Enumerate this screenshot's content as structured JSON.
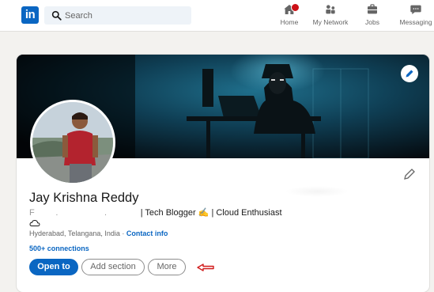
{
  "nav": {
    "logo_text": "in",
    "search_placeholder": "Search",
    "items": [
      {
        "label": "Home",
        "icon": "home-icon"
      },
      {
        "label": "My Network",
        "icon": "network-icon"
      },
      {
        "label": "Jobs",
        "icon": "jobs-icon"
      },
      {
        "label": "Messaging",
        "icon": "messaging-icon"
      }
    ]
  },
  "profile": {
    "name": "Jay Krishna Reddy",
    "headline_blurred": "F        .                  .             ",
    "headline_visible": "| Tech Blogger ✍️ | Cloud Enthusiast",
    "location": "Hyderabad, Telangana, India · ",
    "contact_info": "Contact info",
    "connections": "500+ connections"
  },
  "actions": {
    "open_to": "Open to",
    "add_section": "Add section",
    "more": "More"
  },
  "colors": {
    "brand": "#0a66c2",
    "notification": "#cc1016",
    "arrow": "#d11a1a"
  }
}
